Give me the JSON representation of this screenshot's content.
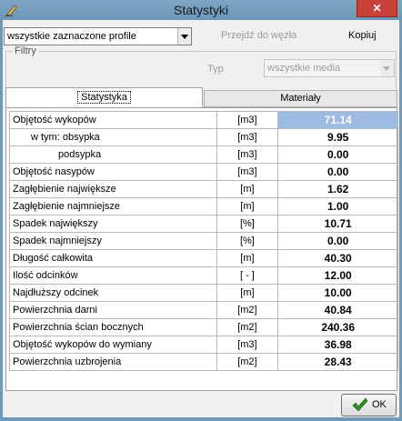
{
  "window": {
    "title": "Statystyki",
    "close_label": "✕"
  },
  "toolbar": {
    "profile_select_value": "wszystkie zaznaczone profile",
    "goto_node_label": "Przejdź do węzła",
    "copy_label": "Kopiuj"
  },
  "filters": {
    "label": "Filtry",
    "type_label": "Typ",
    "type_select_value": "wszystkie media"
  },
  "tabs": {
    "statistics": "Statystyka",
    "materials": "Materiały"
  },
  "stats_rows": [
    {
      "name": "Objętość wykopów",
      "unit": "[m3]",
      "value": "71.14"
    },
    {
      "name": "w tym: obsypka",
      "unit": "[m3]",
      "value": "9.95"
    },
    {
      "name": "podsypka",
      "unit": "[m3]",
      "value": "0.00"
    },
    {
      "name": "Objętość nasypów",
      "unit": "[m3]",
      "value": "0.00"
    },
    {
      "name": "Zagłębienie największe",
      "unit": "[m]",
      "value": "1.62"
    },
    {
      "name": "Zagłębienie najmniejsze",
      "unit": "[m]",
      "value": "1.00"
    },
    {
      "name": "Spadek największy",
      "unit": "[%]",
      "value": "10.71"
    },
    {
      "name": "Spadek najmniejszy",
      "unit": "[%]",
      "value": "0.00"
    },
    {
      "name": "Długość całkowita",
      "unit": "[m]",
      "value": "40.30"
    },
    {
      "name": "Ilość odcinków",
      "unit": "[ - ]",
      "value": "12.00"
    },
    {
      "name": "Najdłuższy odcinek",
      "unit": "[m]",
      "value": "10.00"
    },
    {
      "name": "Powierzchnia darni",
      "unit": "[m2]",
      "value": "40.84"
    },
    {
      "name": "Powierzchnia ścian bocznych",
      "unit": "[m2]",
      "value": "240.36"
    },
    {
      "name": "Objętość wykopów do wymiany",
      "unit": "[m3]",
      "value": "36.98"
    },
    {
      "name": "Powierzchnia uzbrojenia",
      "unit": "[m2]",
      "value": "28.43"
    }
  ],
  "buttons": {
    "ok_label": "OK"
  },
  "colors": {
    "titlebar": "#6f99b8",
    "selection": "#9dbbe0",
    "close": "#c74138",
    "check": "#2f8f1f"
  }
}
